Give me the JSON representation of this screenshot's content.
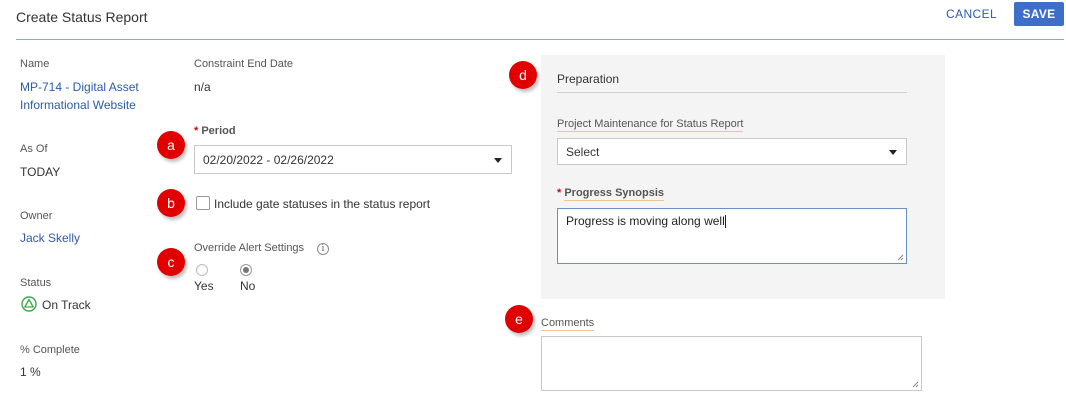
{
  "header": {
    "title": "Create Status Report",
    "cancel_label": "CANCEL",
    "save_label": "SAVE"
  },
  "left": {
    "name_label": "Name",
    "name_value": "MP-714 - Digital Asset Informational Website",
    "as_of_label": "As Of",
    "as_of_value": "TODAY",
    "owner_label": "Owner",
    "owner_value": "Jack Skelly",
    "status_label": "Status",
    "status_value": "On Track",
    "percent_label": "% Complete",
    "percent_value": "1 %"
  },
  "middle": {
    "constraint_label": "Constraint End Date",
    "constraint_value": "n/a",
    "period_required": "*",
    "period_label": "Period",
    "period_value": "02/20/2022 - 02/26/2022",
    "gate_checkbox_label": "Include gate statuses in the status report",
    "gate_checked": false,
    "override_label": "Override Alert Settings",
    "override_yes": "Yes",
    "override_no": "No",
    "override_selected": "No"
  },
  "preparation": {
    "title": "Preparation",
    "maintenance_label": "Project Maintenance for Status Report",
    "maintenance_value": "Select",
    "synopsis_required": "*",
    "synopsis_label": "Progress Synopsis",
    "synopsis_value": "Progress is moving along well"
  },
  "comments": {
    "label": "Comments",
    "value": ""
  },
  "badges": {
    "a": "a",
    "b": "b",
    "c": "c",
    "d": "d",
    "e": "e"
  },
  "colors": {
    "link": "#2a5ca8",
    "save_button": "#3d6ec9",
    "badge": "#e00000",
    "status_on_track": "#3aa84a",
    "panel_bg": "#f4f4f4"
  },
  "icons": {
    "status": "triangle-in-circle-icon",
    "info": "info-icon",
    "dropdown": "caret-down-icon"
  }
}
